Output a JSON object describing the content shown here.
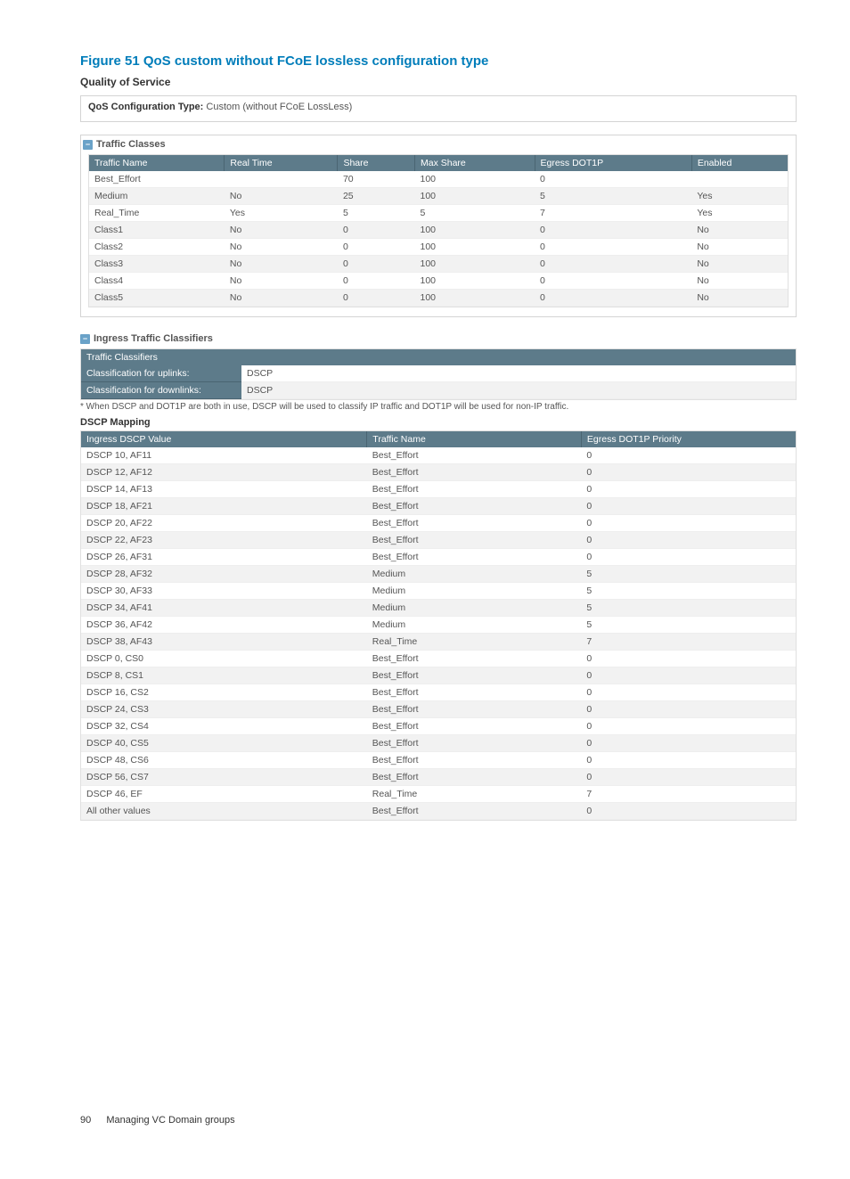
{
  "figure_title": "Figure 51 QoS custom without FCoE lossless configuration type",
  "quality_of_service_heading": "Quality of Service",
  "config_type_label": "QoS Configuration Type:",
  "config_type_value": "Custom (without FCoE LossLess)",
  "traffic_classes_title": "Traffic Classes",
  "traffic_columns": [
    "Traffic Name",
    "Real Time",
    "Share",
    "Max Share",
    "Egress DOT1P",
    "Enabled"
  ],
  "traffic_rows": [
    {
      "name": "Best_Effort",
      "realtime": "",
      "share": "70",
      "max": "100",
      "egress": "0",
      "enabled": ""
    },
    {
      "name": "Medium",
      "realtime": "No",
      "share": "25",
      "max": "100",
      "egress": "5",
      "enabled": "Yes"
    },
    {
      "name": "Real_Time",
      "realtime": "Yes",
      "share": "5",
      "max": "5",
      "egress": "7",
      "enabled": "Yes"
    },
    {
      "name": "Class1",
      "realtime": "No",
      "share": "0",
      "max": "100",
      "egress": "0",
      "enabled": "No"
    },
    {
      "name": "Class2",
      "realtime": "No",
      "share": "0",
      "max": "100",
      "egress": "0",
      "enabled": "No"
    },
    {
      "name": "Class3",
      "realtime": "No",
      "share": "0",
      "max": "100",
      "egress": "0",
      "enabled": "No"
    },
    {
      "name": "Class4",
      "realtime": "No",
      "share": "0",
      "max": "100",
      "egress": "0",
      "enabled": "No"
    },
    {
      "name": "Class5",
      "realtime": "No",
      "share": "0",
      "max": "100",
      "egress": "0",
      "enabled": "No"
    }
  ],
  "ingress_title": "Ingress Traffic Classifiers",
  "classifiers_header": "Traffic Classifiers",
  "classifiers": [
    {
      "label": "Classification for uplinks:",
      "value": "DSCP"
    },
    {
      "label": "Classification for downlinks:",
      "value": "DSCP"
    }
  ],
  "footnote": "* When DSCP and DOT1P are both in use, DSCP will be used to classify IP traffic and DOT1P will be used for non-IP traffic.",
  "dscp_mapping_title": "DSCP Mapping",
  "dscp_columns": [
    "Ingress DSCP Value",
    "Traffic Name",
    "Egress DOT1P Priority"
  ],
  "dscp_rows": [
    {
      "v": "DSCP 10, AF11",
      "t": "Best_Effort",
      "e": "0"
    },
    {
      "v": "DSCP 12, AF12",
      "t": "Best_Effort",
      "e": "0"
    },
    {
      "v": "DSCP 14, AF13",
      "t": "Best_Effort",
      "e": "0"
    },
    {
      "v": "DSCP 18, AF21",
      "t": "Best_Effort",
      "e": "0"
    },
    {
      "v": "DSCP 20, AF22",
      "t": "Best_Effort",
      "e": "0"
    },
    {
      "v": "DSCP 22, AF23",
      "t": "Best_Effort",
      "e": "0"
    },
    {
      "v": "DSCP 26, AF31",
      "t": "Best_Effort",
      "e": "0"
    },
    {
      "v": "DSCP 28, AF32",
      "t": "Medium",
      "e": "5"
    },
    {
      "v": "DSCP 30, AF33",
      "t": "Medium",
      "e": "5"
    },
    {
      "v": "DSCP 34, AF41",
      "t": "Medium",
      "e": "5"
    },
    {
      "v": "DSCP 36, AF42",
      "t": "Medium",
      "e": "5"
    },
    {
      "v": "DSCP 38, AF43",
      "t": "Real_Time",
      "e": "7"
    },
    {
      "v": "DSCP 0, CS0",
      "t": "Best_Effort",
      "e": "0"
    },
    {
      "v": "DSCP 8, CS1",
      "t": "Best_Effort",
      "e": "0"
    },
    {
      "v": "DSCP 16, CS2",
      "t": "Best_Effort",
      "e": "0"
    },
    {
      "v": "DSCP 24, CS3",
      "t": "Best_Effort",
      "e": "0"
    },
    {
      "v": "DSCP 32, CS4",
      "t": "Best_Effort",
      "e": "0"
    },
    {
      "v": "DSCP 40, CS5",
      "t": "Best_Effort",
      "e": "0"
    },
    {
      "v": "DSCP 48, CS6",
      "t": "Best_Effort",
      "e": "0"
    },
    {
      "v": "DSCP 56, CS7",
      "t": "Best_Effort",
      "e": "0"
    },
    {
      "v": "DSCP 46, EF",
      "t": "Real_Time",
      "e": "7"
    },
    {
      "v": "All other values",
      "t": "Best_Effort",
      "e": "0"
    }
  ],
  "footer_page": "90",
  "footer_text": "Managing VC Domain groups"
}
